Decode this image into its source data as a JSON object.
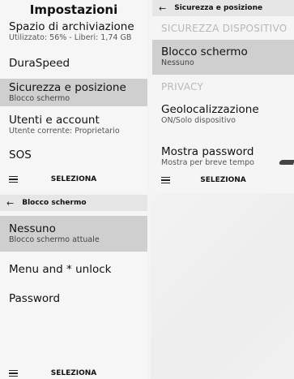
{
  "settings": {
    "title": "Impostazioni",
    "items": [
      {
        "title": "Spazio di archiviazione",
        "subtitle": "Utilizzato: 56% - Liberi: 1,74 GB"
      },
      {
        "title": "DuraSpeed",
        "subtitle": ""
      },
      {
        "title": "Sicurezza e posizione",
        "subtitle": "Blocco schermo"
      },
      {
        "title": "Utenti e account",
        "subtitle": "Utente corrente: Proprietario"
      },
      {
        "title": "SOS",
        "subtitle": ""
      }
    ],
    "softkey": "SELEZIONA"
  },
  "security": {
    "title": "Sicurezza e posizione",
    "section_device": "SICUREZZA DISPOSITIVO",
    "screen_lock": {
      "title": "Blocco schermo",
      "subtitle": "Nessuno"
    },
    "section_privacy": "PRIVACY",
    "location": {
      "title": "Geolocalizzazione",
      "subtitle": "ON/Solo dispositivo"
    },
    "show_password": {
      "title": "Mostra password",
      "subtitle": "Mostra per breve tempo"
    },
    "softkey": "SELEZIONA"
  },
  "lock_screen": {
    "title": "Blocco schermo",
    "options": [
      {
        "title": "Nessuno",
        "subtitle": "Blocco schermo attuale"
      },
      {
        "title": "Menu and * unlock",
        "subtitle": ""
      },
      {
        "title": "Password",
        "subtitle": ""
      }
    ],
    "softkey": "SELEZIONA"
  },
  "icons": {
    "back": "back-arrow-icon",
    "menu": "menu-icon"
  },
  "colors": {
    "highlight": "#cfcfcf",
    "header_bar": "#e6e6e6",
    "section_text": "#b8b8b8"
  }
}
